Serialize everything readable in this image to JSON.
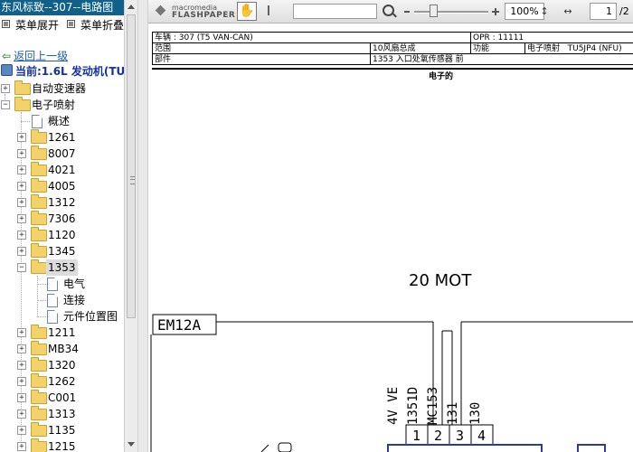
{
  "app": {
    "title": "东风标致--307--电路图"
  },
  "menu": {
    "expand_label": "菜单展开",
    "collapse_label": "菜单折叠"
  },
  "nav": {
    "back_label": "返回上一级",
    "current_label": "当前:1.6L 发动机(TU"
  },
  "tree": {
    "auto_transmission": "自动变速器",
    "efi": "电子喷射",
    "overview": "概述",
    "folders_before": [
      "1261",
      "8007",
      "4021",
      "4005",
      "1312",
      "7306",
      "1120",
      "1345"
    ],
    "selected_folder": "1353",
    "children": [
      "电气",
      "连接",
      "元件位置图"
    ],
    "folders_after": [
      "1211",
      "MB34",
      "1320",
      "1262",
      "C001",
      "1313",
      "1135",
      "1215"
    ]
  },
  "toolbar": {
    "logo_top": "macromedia",
    "logo_bottom": "FLASHPAPER",
    "hand_icon": "✋",
    "text_icon": "I",
    "search_value": "",
    "zoom_value": "100%",
    "zoom_level": 0.25,
    "fit_height_icon": "↕",
    "fit_width_icon": "↔",
    "page_current": "1",
    "page_total": "/2"
  },
  "doc": {
    "vehicle": "车辆 : 307 (T5 VAN-CAN)",
    "opr": "OPR : 11111",
    "scope_label": "范围",
    "scope_value": "10风扇总成",
    "function_label": "功能",
    "function_value": "电子喷射",
    "function_code": "TU5JP4 (NFU)",
    "part_label": "部件",
    "part_value": "1353 入口处氧传感器 前",
    "electrical_label": "电子的"
  },
  "diagram": {
    "title": "20 MOT",
    "connector_label": "EM12A",
    "wire_labels": [
      "4V VE",
      "1351D",
      "MC153",
      "131",
      "130"
    ],
    "pins": [
      "1",
      "2",
      "3",
      "4"
    ]
  }
}
